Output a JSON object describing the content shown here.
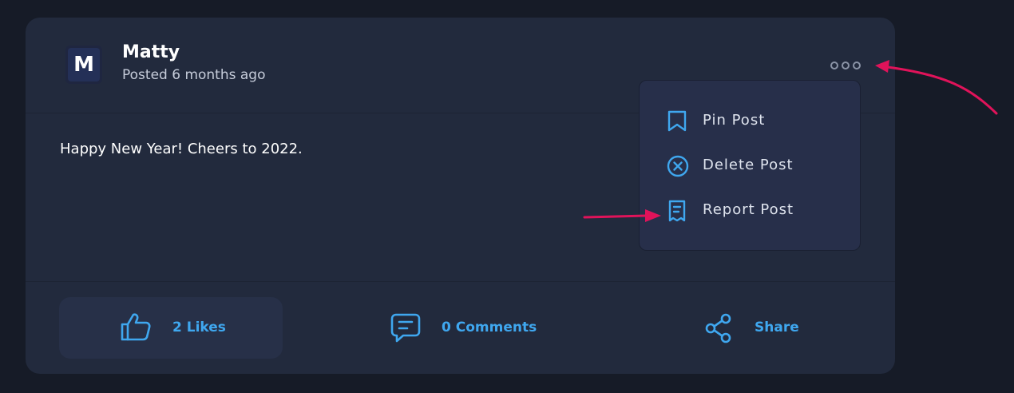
{
  "post": {
    "author": "Matty",
    "avatar_letter": "M",
    "posted": "Posted 6 months ago",
    "content": "Happy New Year! Cheers to 2022."
  },
  "menu": {
    "items": [
      {
        "label": "Pin Post",
        "icon": "bookmark-icon"
      },
      {
        "label": "Delete Post",
        "icon": "close-circle-icon"
      },
      {
        "label": "Report Post",
        "icon": "receipt-icon"
      }
    ]
  },
  "actions": {
    "likes": "2 Likes",
    "comments": "0 Comments",
    "share": "Share"
  },
  "colors": {
    "accent": "#3fa7ef",
    "annotation_arrow": "#e0135a",
    "card_bg": "#222a3d",
    "page_bg": "#161b27"
  }
}
